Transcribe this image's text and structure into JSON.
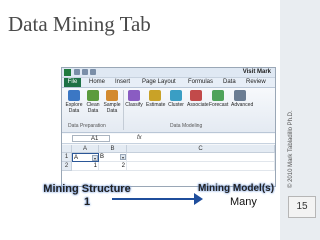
{
  "slide": {
    "title": "Data Mining Tab",
    "copyright": "© 2010 Mark Tabladillo Ph.D.",
    "page_number": "15"
  },
  "excel": {
    "title": "Visit Mark",
    "tabs": [
      "File",
      "Home",
      "Insert",
      "Page Layout",
      "Formulas",
      "Data",
      "Review"
    ],
    "ribbon_buttons": [
      {
        "label": "Explore\nData",
        "icon": "explore-data-icon"
      },
      {
        "label": "Clean\nData",
        "icon": "clean-data-icon"
      },
      {
        "label": "Sample\nData",
        "icon": "sample-data-icon"
      },
      {
        "label": "Classify",
        "icon": "classify-icon"
      },
      {
        "label": "Estimate",
        "icon": "estimate-icon"
      },
      {
        "label": "Cluster",
        "icon": "cluster-icon"
      },
      {
        "label": "Associate",
        "icon": "associate-icon"
      },
      {
        "label": "Forecast",
        "icon": "forecast-icon"
      },
      {
        "label": "Advanced",
        "icon": "advanced-icon"
      }
    ],
    "group_labels": [
      "Data Preparation",
      "Data Modeling"
    ],
    "namebox": "A1",
    "fx": "fx",
    "columns": [
      "A",
      "B",
      "C"
    ],
    "rows": [
      "1",
      "2"
    ],
    "cells": [
      [
        "A",
        "B",
        ""
      ],
      [
        "1",
        "2",
        ""
      ]
    ]
  },
  "captions": {
    "left": "Mining Structure",
    "left_count": "1",
    "right": "Mining Model(s)",
    "right_count": "Many"
  },
  "colors": {
    "file_tab": "#1e7145",
    "caption_glow": "#7fa3e0"
  }
}
